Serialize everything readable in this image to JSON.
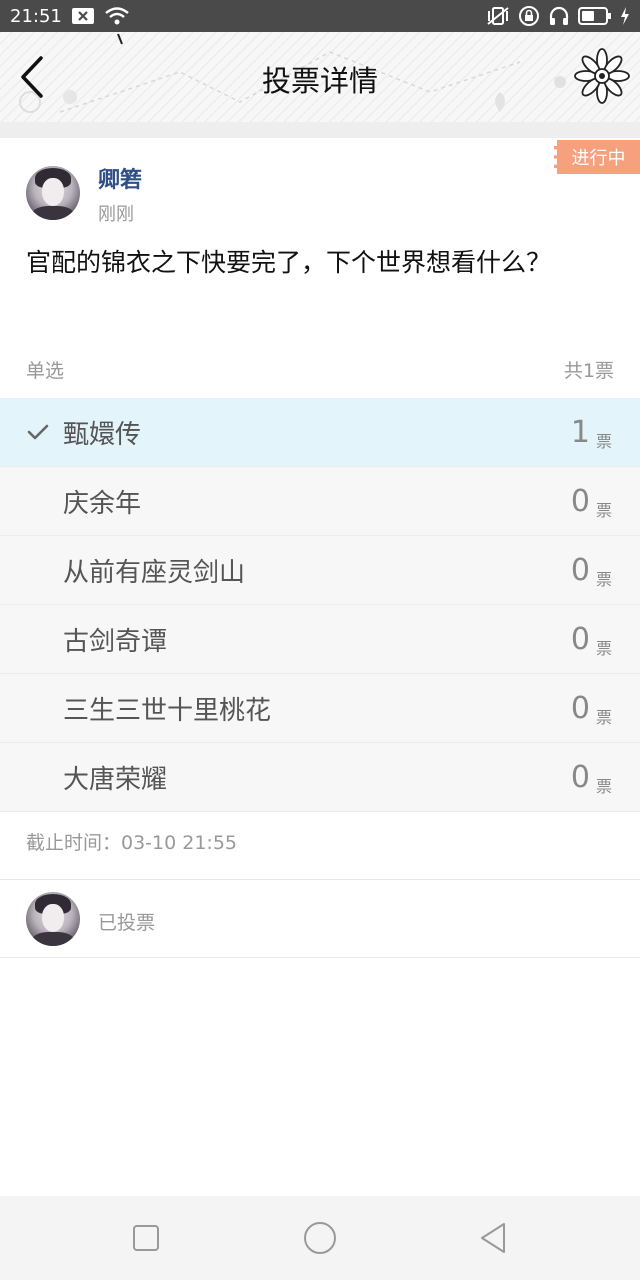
{
  "status_bar": {
    "time": "21:51",
    "icons": [
      "close-box-icon",
      "wifi-icon",
      "vibrate-icon",
      "rotation-lock-icon",
      "headphones-icon",
      "battery-icon",
      "charging-icon"
    ]
  },
  "header": {
    "title": "投票详情",
    "back_icon": "chevron-left-icon",
    "flower_icon": "flower-icon"
  },
  "post": {
    "status_tag": "进行中",
    "author": "卿箬",
    "time": "刚刚",
    "text": "官配的锦衣之下快要完了，下个世界想看什么？"
  },
  "vote": {
    "mode": "单选",
    "total": "共1票",
    "options": [
      {
        "label": "甄嬛传",
        "count": "1",
        "unit": "票",
        "selected": true
      },
      {
        "label": "庆余年",
        "count": "0",
        "unit": "票",
        "selected": false
      },
      {
        "label": "从前有座灵剑山",
        "count": "0",
        "unit": "票",
        "selected": false
      },
      {
        "label": "古剑奇谭",
        "count": "0",
        "unit": "票",
        "selected": false
      },
      {
        "label": "三生三世十里桃花",
        "count": "0",
        "unit": "票",
        "selected": false
      },
      {
        "label": "大唐荣耀",
        "count": "0",
        "unit": "票",
        "selected": false
      }
    ],
    "deadline": "截止时间：03-10 21:55"
  },
  "voter": {
    "status": "已投票"
  },
  "colors": {
    "accent_tag": "#f6a07e",
    "author_name": "#2f4f86",
    "selected_row": "#e3f4fb"
  },
  "nav": {
    "icons": [
      "square-icon",
      "circle-icon",
      "triangle-back-icon"
    ]
  }
}
